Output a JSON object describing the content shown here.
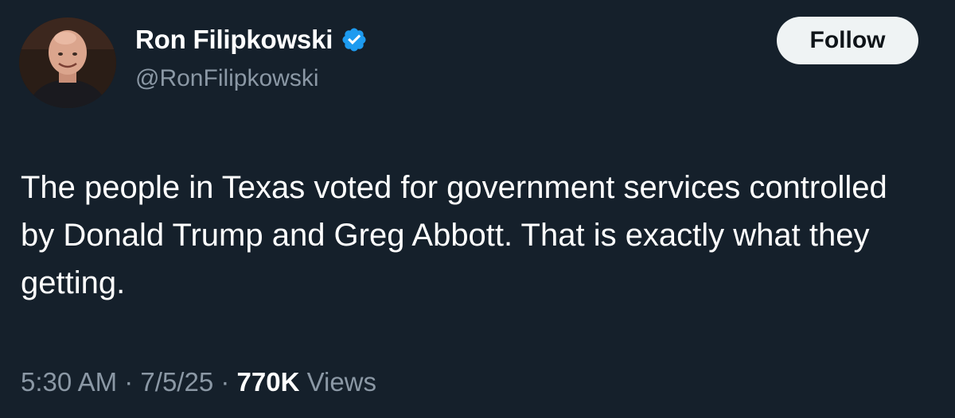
{
  "author": {
    "display_name": "Ron Filipkowski",
    "handle": "@RonFilipkowski",
    "verified": true
  },
  "follow_button": {
    "label": "Follow"
  },
  "tweet": {
    "text": "The people in Texas voted for government services controlled by Donald Trump and Greg Abbott. That is exactly what they getting."
  },
  "meta": {
    "time": "5:30 AM",
    "separator": "·",
    "date": "7/5/25",
    "views_count": "770K",
    "views_label": "Views"
  },
  "icons": {
    "verified": "verified-badge-icon"
  },
  "colors": {
    "background": "#15202b",
    "verified_blue": "#1d9bf0",
    "secondary_text": "#8b98a5",
    "follow_bg": "#eff3f4"
  }
}
